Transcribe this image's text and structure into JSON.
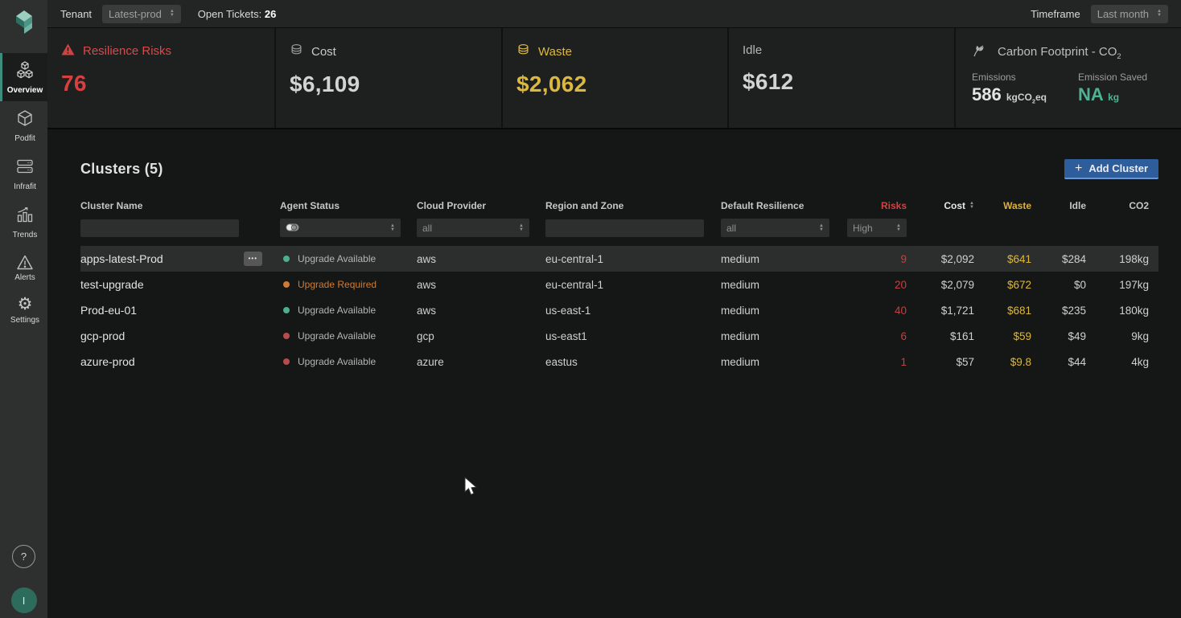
{
  "topbar": {
    "tenant_label": "Tenant",
    "tenant_value": "Latest-prod",
    "open_tickets_label": "Open Tickets:",
    "open_tickets_value": "26",
    "timeframe_label": "Timeframe",
    "timeframe_value": "Last month"
  },
  "sidebar": {
    "items": [
      {
        "label": "Overview",
        "active": true
      },
      {
        "label": "Podfit",
        "active": false
      },
      {
        "label": "Infrafit",
        "active": false
      },
      {
        "label": "Trends",
        "active": false
      },
      {
        "label": "Alerts",
        "active": false
      },
      {
        "label": "Settings",
        "active": false
      }
    ],
    "help_label": "?",
    "avatar_initial": "I"
  },
  "kpis": {
    "resilience": {
      "label": "Resilience Risks",
      "value": "76"
    },
    "cost": {
      "label": "Cost",
      "value": "$6,109"
    },
    "waste": {
      "label": "Waste",
      "value": "$2,062"
    },
    "idle": {
      "label": "Idle",
      "value": "$612"
    },
    "carbon": {
      "title": "Carbon Footprint - CO",
      "title_sub": "2",
      "emissions_label": "Emissions",
      "emissions_value": "586",
      "emissions_unit_prefix": "kgCO",
      "emissions_unit_sub": "2",
      "emissions_unit_suffix": "eq",
      "saved_label": "Emission Saved",
      "saved_value": "NA",
      "saved_unit": "kg"
    }
  },
  "clusters": {
    "title": "Clusters (5)",
    "add_button_icon": "+",
    "add_button_label": "Add Cluster",
    "columns": [
      {
        "label": "Cluster Name"
      },
      {
        "label": "Agent Status"
      },
      {
        "label": "Cloud Provider"
      },
      {
        "label": "Region and Zone"
      },
      {
        "label": "Default Resilience"
      },
      {
        "label": "Risks"
      },
      {
        "label": "Cost"
      },
      {
        "label": "Waste"
      },
      {
        "label": "Idle"
      },
      {
        "label": "CO2"
      }
    ],
    "filters": {
      "cluster_name_value": "",
      "cloud_provider_value": "all",
      "region_value": "",
      "default_resilience_value": "all",
      "risks_value": "High"
    },
    "rows": [
      {
        "name": "apps-latest-Prod",
        "highlighted": true,
        "has_menu": true,
        "status": {
          "dot": "#4caf8e",
          "label": "Upgrade Available",
          "color": "#b4b4b4"
        },
        "provider": "aws",
        "region": "eu-central-1",
        "resilience": "medium",
        "risks": "9",
        "cost": "$2,092",
        "waste": "$641",
        "idle": "$284",
        "co2": "198kg"
      },
      {
        "name": "test-upgrade",
        "highlighted": false,
        "has_menu": false,
        "status": {
          "dot": "#cf7c32",
          "label": "Upgrade Required",
          "color": "#cf7c32"
        },
        "provider": "aws",
        "region": "eu-central-1",
        "resilience": "medium",
        "risks": "20",
        "cost": "$2,079",
        "waste": "$672",
        "idle": "$0",
        "co2": "197kg"
      },
      {
        "name": "Prod-eu-01",
        "highlighted": false,
        "has_menu": false,
        "status": {
          "dot": "#4caf8e",
          "label": "Upgrade Available",
          "color": "#b4b4b4"
        },
        "provider": "aws",
        "region": "us-east-1",
        "resilience": "medium",
        "risks": "40",
        "cost": "$1,721",
        "waste": "$681",
        "idle": "$235",
        "co2": "180kg"
      },
      {
        "name": "gcp-prod",
        "highlighted": false,
        "has_menu": false,
        "status": {
          "dot": "#b94b4f",
          "label": "Upgrade Available",
          "color": "#b4b4b4"
        },
        "provider": "gcp",
        "region": "us-east1",
        "resilience": "medium",
        "risks": "6",
        "cost": "$161",
        "waste": "$59",
        "idle": "$49",
        "co2": "9kg"
      },
      {
        "name": "azure-prod",
        "highlighted": false,
        "has_menu": false,
        "status": {
          "dot": "#b94b4f",
          "label": "Upgrade Available",
          "color": "#b4b4b4"
        },
        "provider": "azure",
        "region": "eastus",
        "resilience": "medium",
        "risks": "1",
        "cost": "$57",
        "waste": "$9.8",
        "idle": "$44",
        "co2": "4kg"
      }
    ]
  },
  "icons": {
    "ellipsis": "•••",
    "alerts_glyph": "⚠",
    "settings_glyph": "⚙"
  },
  "colors": {
    "accent_red": "#d84040",
    "accent_yellow": "#ddb83e",
    "accent_teal": "#4eb392",
    "accent_orange": "#cf7c32",
    "accent_blue": "#2e5d9c",
    "dot_green": "#4caf8e",
    "dot_red": "#b94b4f"
  }
}
